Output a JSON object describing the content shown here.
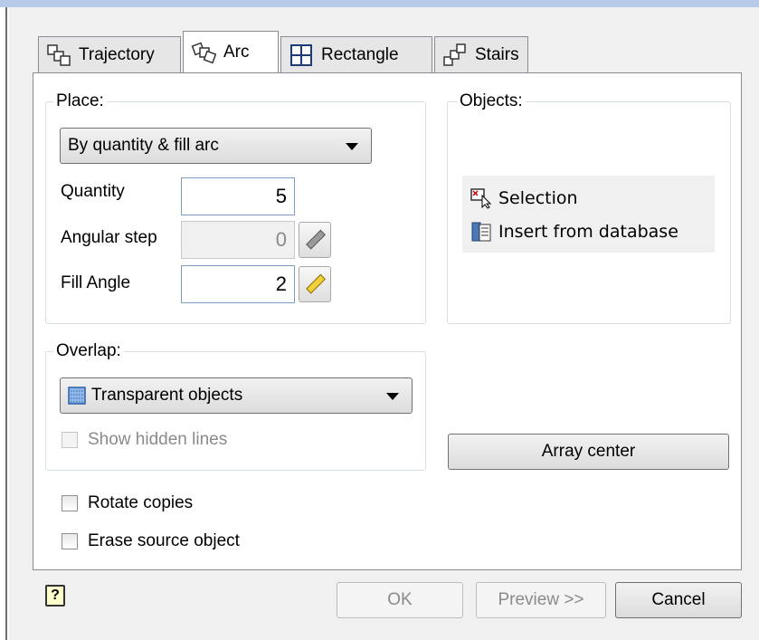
{
  "tabs": [
    {
      "label": "Trajectory",
      "icon": "trajectory-icon",
      "active": false
    },
    {
      "label": "Arc",
      "icon": "arc-array-icon",
      "active": true
    },
    {
      "label": "Rectangle",
      "icon": "rectangle-grid-icon",
      "active": false
    },
    {
      "label": "Stairs",
      "icon": "stairs-icon",
      "active": false
    }
  ],
  "place": {
    "group_label": "Place:",
    "mode_value": "By quantity & fill arc",
    "quantity_label": "Quantity",
    "quantity_value": "5",
    "angular_step_label": "Angular step",
    "angular_step_value": "0",
    "fill_angle_label": "Fill Angle",
    "fill_angle_value": "2"
  },
  "objects": {
    "group_label": "Objects:",
    "items": [
      {
        "label": "Selection",
        "icon": "selection-cursor-icon"
      },
      {
        "label": "Insert from database",
        "icon": "database-insert-icon"
      }
    ]
  },
  "overlap": {
    "group_label": "Overlap:",
    "mode_value": "Transparent objects",
    "mode_icon": "transparent-objects-icon",
    "show_hidden_lines_label": "Show hidden lines",
    "show_hidden_lines_checked": false
  },
  "array_center_label": "Array center",
  "options": {
    "rotate_copies_label": "Rotate copies",
    "rotate_copies_checked": false,
    "erase_source_label": "Erase source object",
    "erase_source_checked": false
  },
  "footer": {
    "help_icon": "help-icon",
    "ok_label": "OK",
    "preview_label": "Preview >>",
    "cancel_label": "Cancel"
  },
  "colors": {
    "accent": "#7a9cc9",
    "title_strip": "#b7cbe6"
  }
}
